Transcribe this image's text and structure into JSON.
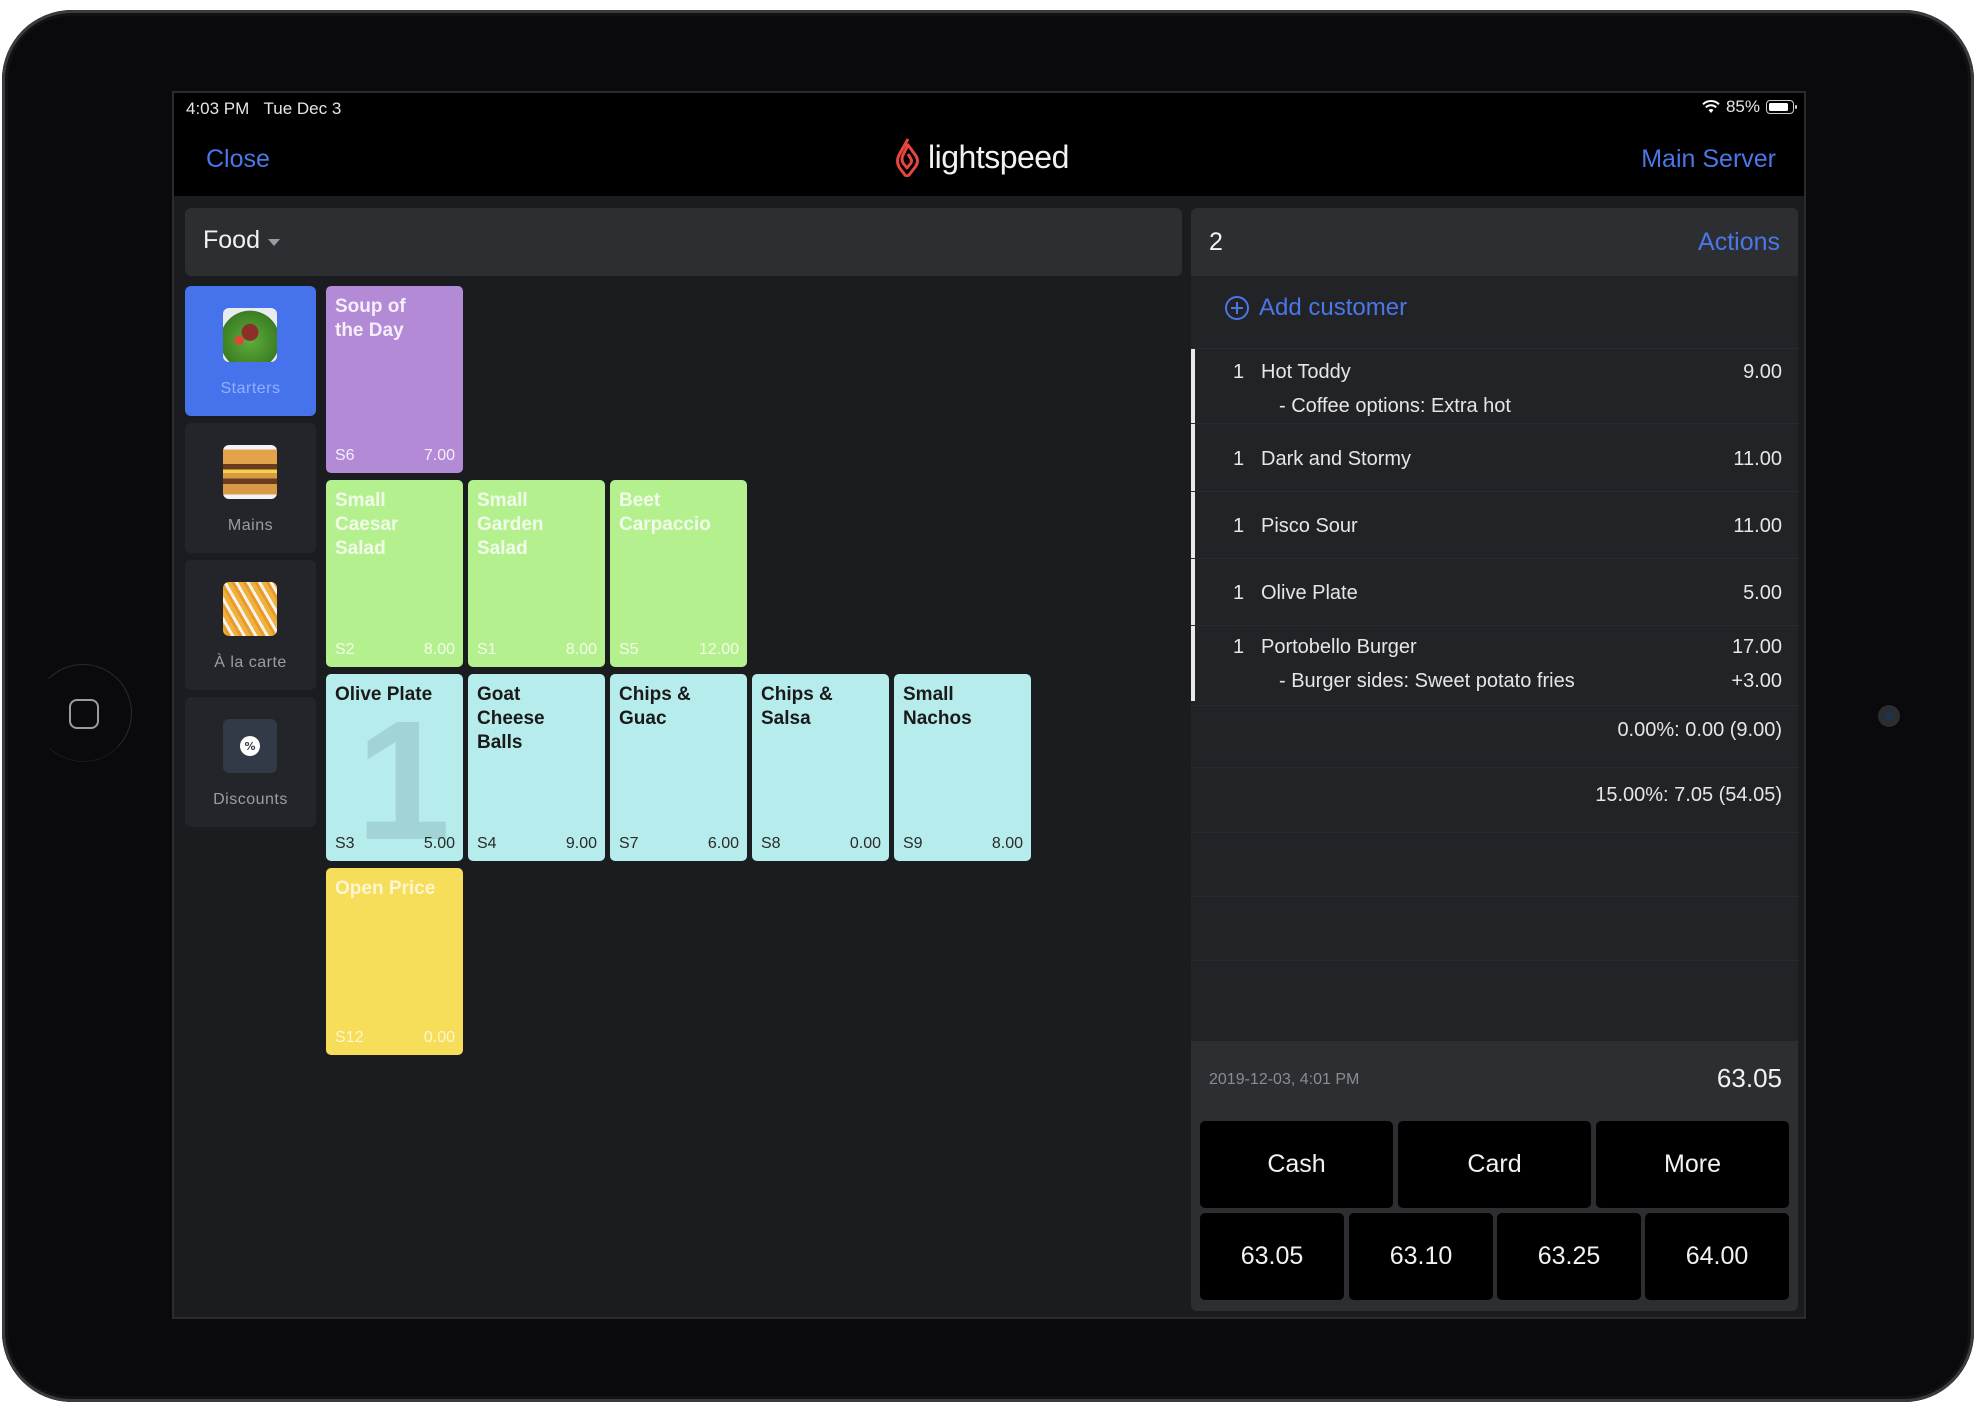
{
  "status_bar": {
    "time": "4:03 PM",
    "date": "Tue Dec 3",
    "battery": "85%"
  },
  "nav": {
    "close_label": "Close",
    "brand": "lightspeed",
    "server_label": "Main Server"
  },
  "menu": {
    "selected_menu": "Food"
  },
  "categories": [
    {
      "label": "Starters",
      "icon": "salad-image",
      "active": true
    },
    {
      "label": "Mains",
      "icon": "burger-image",
      "active": false
    },
    {
      "label": "À la carte",
      "icon": "fries-image",
      "active": false
    },
    {
      "label": "Discounts",
      "icon": "discount-icon",
      "active": false
    }
  ],
  "items": [
    {
      "name": "Soup of the Day",
      "code": "S6",
      "price": "7.00",
      "color": "purple"
    },
    {
      "name": "Small Caesar Salad",
      "code": "S2",
      "price": "8.00",
      "color": "green"
    },
    {
      "name": "Small Garden Salad",
      "code": "S1",
      "price": "8.00",
      "color": "green"
    },
    {
      "name": "Beet Carpaccio",
      "code": "S5",
      "price": "12.00",
      "color": "green"
    },
    {
      "name": "Olive Plate",
      "code": "S3",
      "price": "5.00",
      "color": "cyan",
      "qty_badge": "1"
    },
    {
      "name": "Goat Cheese Balls",
      "code": "S4",
      "price": "9.00",
      "color": "cyan"
    },
    {
      "name": "Chips & Guac",
      "code": "S7",
      "price": "6.00",
      "color": "cyan"
    },
    {
      "name": "Chips & Salsa",
      "code": "S8",
      "price": "0.00",
      "color": "cyan"
    },
    {
      "name": "Small Nachos",
      "code": "S9",
      "price": "8.00",
      "color": "cyan"
    },
    {
      "name": "Open Price",
      "code": "S12",
      "price": "0.00",
      "color": "yellow"
    }
  ],
  "order": {
    "table_number": "2",
    "actions_label": "Actions",
    "add_customer_label": "Add customer",
    "lines": [
      {
        "qty": "1",
        "name": "Hot Toddy",
        "price": "9.00",
        "modifier": "- Coffee options:  Extra hot",
        "modifier_price": ""
      },
      {
        "qty": "1",
        "name": "Dark and Stormy",
        "price": "11.00"
      },
      {
        "qty": "1",
        "name": "Pisco Sour",
        "price": "11.00"
      },
      {
        "qty": "1",
        "name": "Olive Plate",
        "price": "5.00"
      },
      {
        "qty": "1",
        "name": "Portobello Burger",
        "price": "17.00",
        "modifier": "- Burger sides:  Sweet potato fries",
        "modifier_price": "+3.00"
      }
    ],
    "taxes": [
      "0.00%: 0.00 (9.00)",
      "15.00%: 7.05 (54.05)"
    ],
    "timestamp": "2019-12-03, 4:01 PM",
    "total": "63.05"
  },
  "payment": {
    "methods": [
      "Cash",
      "Card",
      "More"
    ],
    "quick_amounts": [
      "63.05",
      "63.10",
      "63.25",
      "64.00"
    ]
  },
  "colors": {
    "accent": "#4a77e8",
    "brand_red": "#e5463f",
    "active_category": "#4673ec",
    "tile_purple": "#b38ad6",
    "tile_green": "#b4f18e",
    "tile_cyan": "#b6ecec",
    "tile_yellow": "#f6dd5a"
  }
}
